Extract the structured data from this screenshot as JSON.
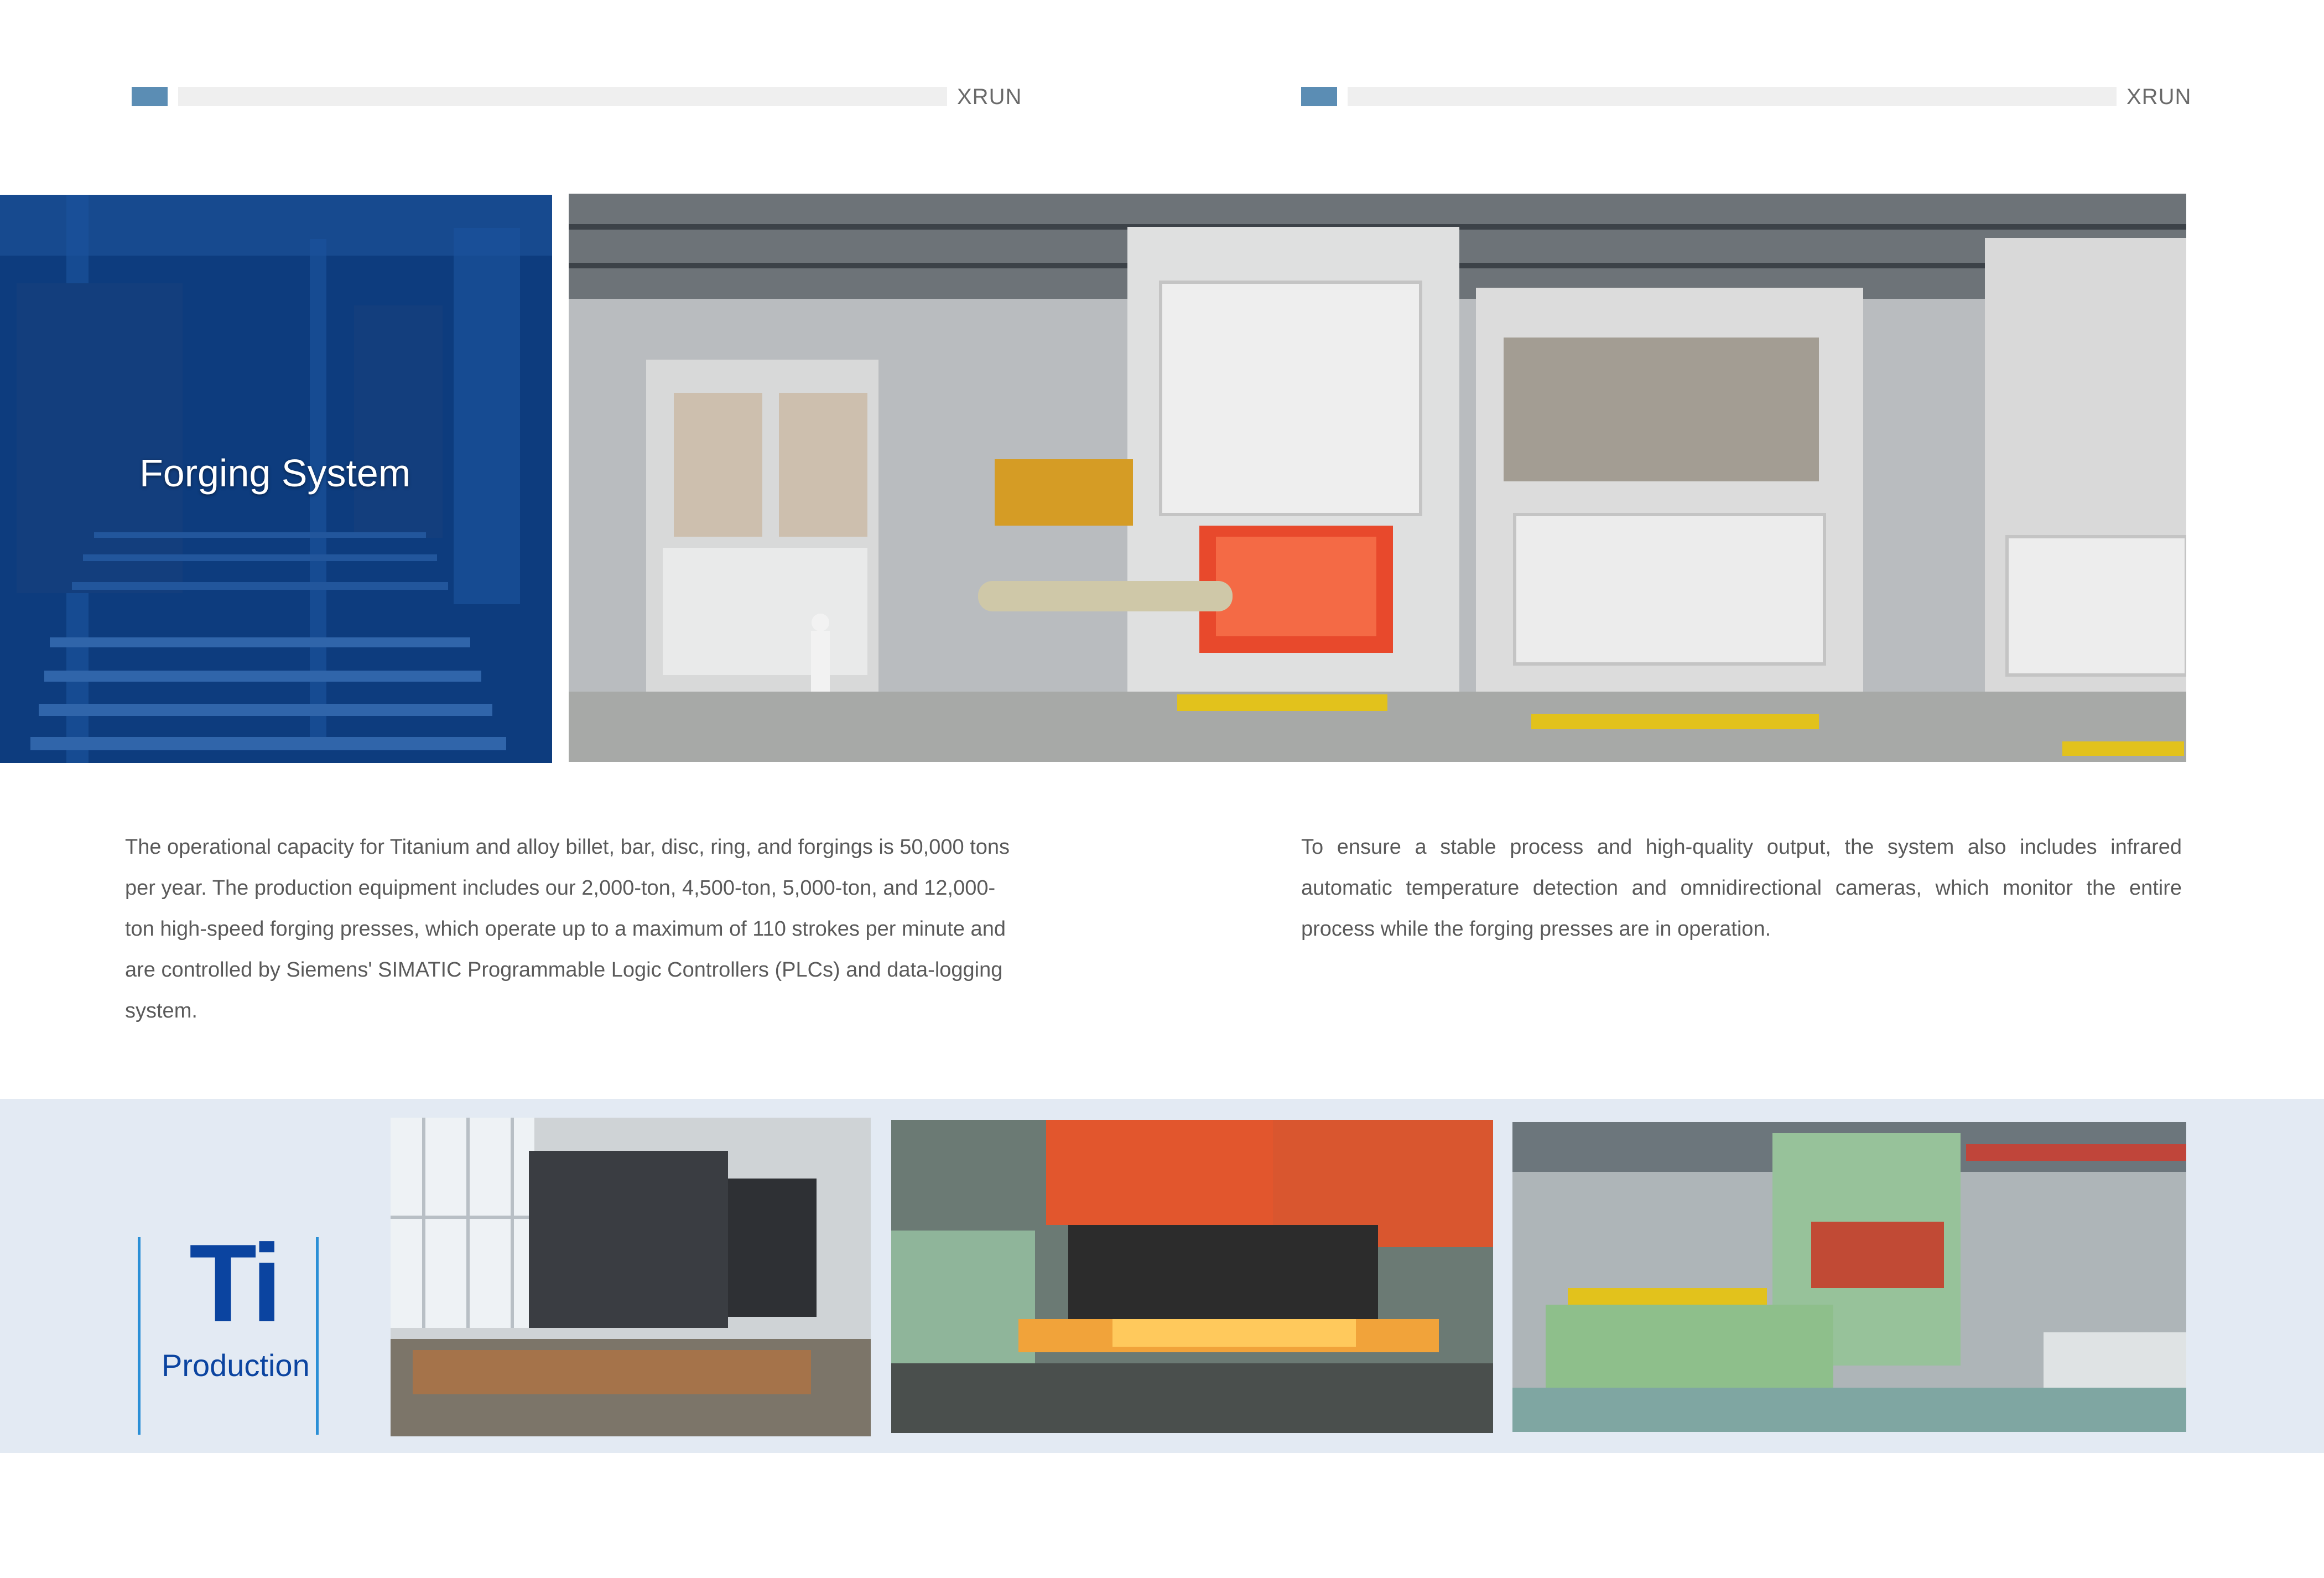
{
  "header": {
    "left_brand": "XRUN",
    "right_brand": "XRUN",
    "accent_color": "#5b8db4"
  },
  "hero": {
    "title": "Forging System",
    "overlay_color": "#0b3f86",
    "photo_left_desc": "blue-tinted-conveyor-photo",
    "photo_main_desc": "heat-treatment-furnaces-photo"
  },
  "text": {
    "left_paragraph": "The operational capacity for Titanium and alloy billet, bar, disc, ring, and forgings is 50,000 tons per year. The production equipment includes our 2,000-ton, 4,500-ton, 5,000-ton, and 12,000-ton high-speed forging presses, which operate up to a maximum of 110 strokes per minute and are controlled by Siemens' SIMATIC Programmable Logic Controllers (PLCs) and data-logging system.",
    "right_paragraph": "To ensure a stable process and high-quality output, the system also includes infrared automatic temperature detection and omnidirectional cameras, which monitor the entire process while the forging presses are in operation."
  },
  "bottom_band": {
    "logo_main": "Ti",
    "logo_sub": "Production",
    "logo_color": "#0b44a0",
    "band_color": "#e3eaf3"
  }
}
